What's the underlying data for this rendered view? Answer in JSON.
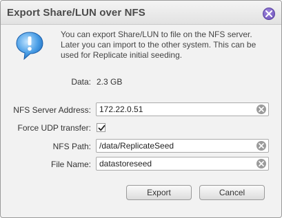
{
  "dialog": {
    "title": "Export Share/LUN over NFS",
    "message": "You can export Share/LUN to file on the NFS server. Later you can import to the other system. This can be used for Replicate initial seeding."
  },
  "data_row": {
    "label": "Data:",
    "value": "2.3 GB"
  },
  "form": {
    "nfs_server": {
      "label": "NFS Server Address:",
      "value": "172.22.0.51"
    },
    "force_udp": {
      "label": "Force UDP transfer:",
      "checked": true
    },
    "nfs_path": {
      "label": "NFS Path:",
      "value": "/data/ReplicateSeed"
    },
    "file_name": {
      "label": "File Name:",
      "value": "datastoreseed"
    }
  },
  "buttons": {
    "export": "Export",
    "cancel": "Cancel"
  },
  "icons": {
    "close": "close-icon",
    "info": "info-bubble-icon",
    "clear": "clear-icon",
    "check": "check-icon"
  },
  "colors": {
    "close_accent": "#7a5fc4",
    "title_text": "#4a4a4a",
    "info_blue": "#3a8fd8"
  }
}
